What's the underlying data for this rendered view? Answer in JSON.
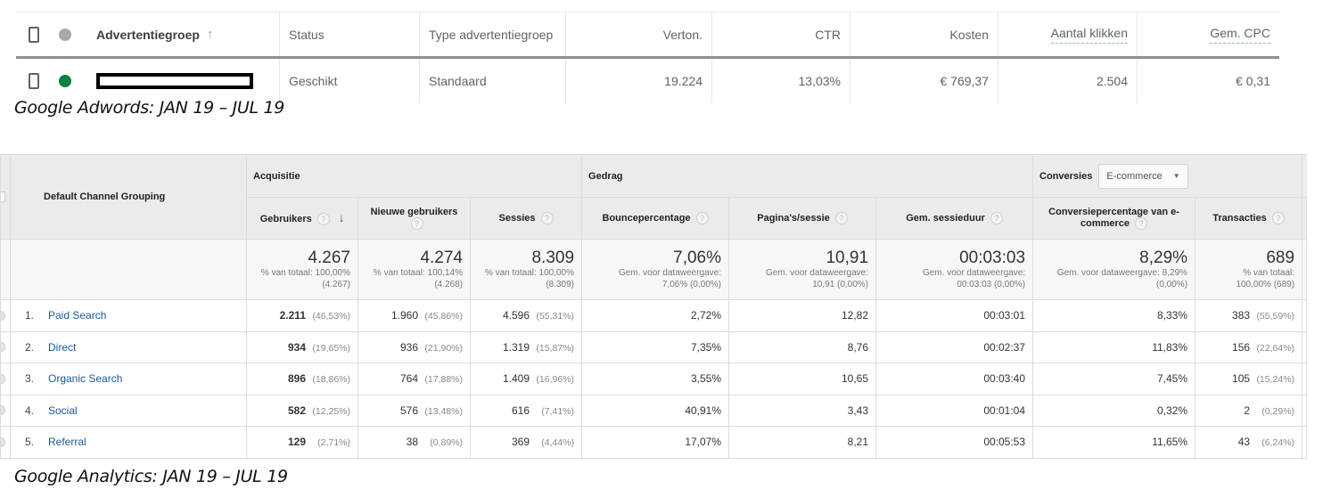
{
  "adwords": {
    "columns": {
      "name": "Advertentiegroep",
      "status": "Status",
      "type": "Type advertentiegroep",
      "impressions": "Verton.",
      "ctr": "CTR",
      "cost": "Kosten",
      "clicks": "Aantal klikken",
      "avg_cpc": "Gem. CPC"
    },
    "sort_icon": "arrow-up",
    "rows": [
      {
        "status_color": "#0b8043",
        "name_redacted": true,
        "status": "Geschikt",
        "type": "Standaard",
        "impressions": "19.224",
        "ctr": "13,03%",
        "cost": "€ 769,37",
        "clicks": "2.504",
        "avg_cpc": "€ 0,31"
      }
    ],
    "caption": "Google Adwords: JAN 19 – JUL 19"
  },
  "analytics": {
    "dimension_header": "Default Channel Grouping",
    "groups": {
      "acquisition": "Acquisitie",
      "behavior": "Gedrag",
      "conversions": "Conversies",
      "conversions_select": "E-commerce"
    },
    "columns": [
      {
        "label": "Gebruikers",
        "help": "?",
        "sorted": "desc"
      },
      {
        "label": "Nieuwe gebruikers",
        "help": "?"
      },
      {
        "label": "Sessies",
        "help": "?"
      },
      {
        "label": "Bouncepercentage",
        "help": "?"
      },
      {
        "label": "Pagina's/sessie",
        "help": "?"
      },
      {
        "label": "Gem. sessieduur",
        "help": "?"
      },
      {
        "label": "Conversiepercentage van e-commerce",
        "help": "?"
      },
      {
        "label": "Transacties",
        "help": "?"
      }
    ],
    "totals": [
      {
        "value": "4.267",
        "line1": "% van totaal: 100,00%",
        "line2": "(4.267)"
      },
      {
        "value": "4.274",
        "line1": "% van totaal: 100,14%",
        "line2": "(4.268)"
      },
      {
        "value": "8.309",
        "line1": "% van totaal: 100,00%",
        "line2": "(8.309)"
      },
      {
        "value": "7,06%",
        "line1": "Gem. voor dataweergave:",
        "line2": "7,06% (0,00%)"
      },
      {
        "value": "10,91",
        "line1": "Gem. voor dataweergave:",
        "line2": "10,91 (0,00%)"
      },
      {
        "value": "00:03:03",
        "line1": "Gem. voor dataweergave:",
        "line2": "00:03:03 (0,00%)"
      },
      {
        "value": "8,29%",
        "line1": "Gem. voor dataweergave: 8,29%",
        "line2": "(0,00%)"
      },
      {
        "value": "689",
        "line1": "% van totaal:",
        "line2": "100,00% (689)"
      }
    ],
    "rows": [
      {
        "rank": "1.",
        "channel": "Paid Search",
        "users": "2.211",
        "users_pct": "(46,53%)",
        "new_users": "1.960",
        "new_users_pct": "(45,86%)",
        "sessions": "4.596",
        "sessions_pct": "(55,31%)",
        "bounce": "2,72%",
        "pages": "12,82",
        "duration": "00:03:01",
        "conv_rate": "8,33%",
        "transactions": "383",
        "transactions_pct": "(55,59%)"
      },
      {
        "rank": "2.",
        "channel": "Direct",
        "users": "934",
        "users_pct": "(19,65%)",
        "new_users": "936",
        "new_users_pct": "(21,90%)",
        "sessions": "1.319",
        "sessions_pct": "(15,87%)",
        "bounce": "7,35%",
        "pages": "8,76",
        "duration": "00:02:37",
        "conv_rate": "11,83%",
        "transactions": "156",
        "transactions_pct": "(22,64%)"
      },
      {
        "rank": "3.",
        "channel": "Organic Search",
        "users": "896",
        "users_pct": "(18,86%)",
        "new_users": "764",
        "new_users_pct": "(17,88%)",
        "sessions": "1.409",
        "sessions_pct": "(16,96%)",
        "bounce": "3,55%",
        "pages": "10,65",
        "duration": "00:03:40",
        "conv_rate": "7,45%",
        "transactions": "105",
        "transactions_pct": "(15,24%)"
      },
      {
        "rank": "4.",
        "channel": "Social",
        "users": "582",
        "users_pct": "(12,25%)",
        "new_users": "576",
        "new_users_pct": "(13,48%)",
        "sessions": "616",
        "sessions_pct": "(7,41%)",
        "bounce": "40,91%",
        "pages": "3,43",
        "duration": "00:01:04",
        "conv_rate": "0,32%",
        "transactions": "2",
        "transactions_pct": "(0,29%)"
      },
      {
        "rank": "5.",
        "channel": "Referral",
        "users": "129",
        "users_pct": "(2,71%)",
        "new_users": "38",
        "new_users_pct": "(0,89%)",
        "sessions": "369",
        "sessions_pct": "(4,44%)",
        "bounce": "17,07%",
        "pages": "8,21",
        "duration": "00:05:53",
        "conv_rate": "11,65%",
        "transactions": "43",
        "transactions_pct": "(6,24%)"
      }
    ],
    "caption": "Google Analytics: JAN 19 – JUL 19"
  }
}
